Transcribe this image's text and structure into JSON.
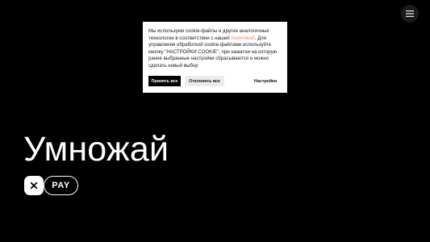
{
  "header": {
    "menu_icon": "hamburger-menu-icon"
  },
  "cookie_banner": {
    "text_part1": "Мы используем cookie-файлы и другие аналогичные технологии в соответствии с нашей ",
    "policy_link": "политикой",
    "text_part2": ". Для управления обработкой cookie-файлами используйте кнопку \"НАСТРОЙКИ COOKIE\", при нажатии на которую ранее выбранные настройки сбрасываются и можно сделать новый выбор",
    "accept_label": "Принять все",
    "reject_label": "Отклонить все",
    "settings_label": "Настройки",
    "link_color": "#f0845a"
  },
  "hero": {
    "title": "Умножай"
  },
  "brand": {
    "mark_icon": "x-logo-icon",
    "pay_label": "PAY"
  }
}
